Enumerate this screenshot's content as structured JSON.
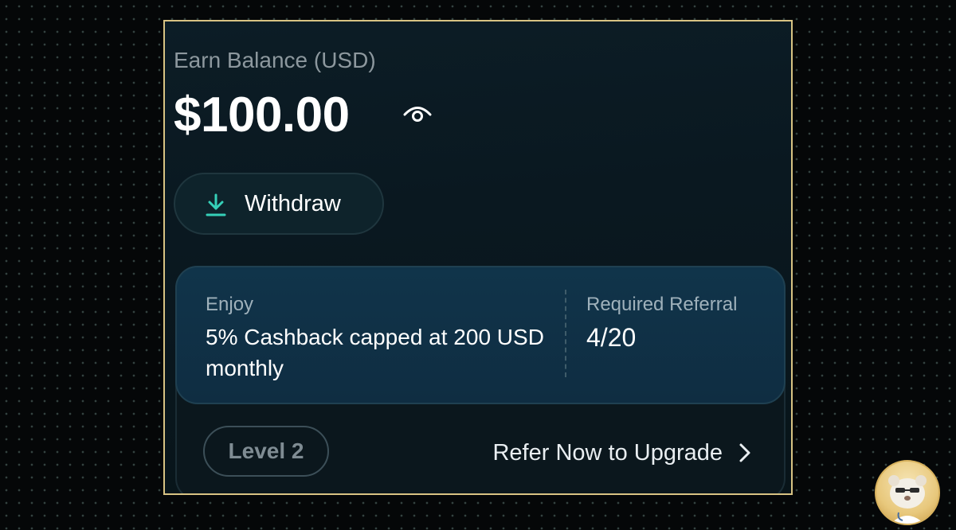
{
  "balance": {
    "label": "Earn Balance (USD)",
    "amount": "$100.00",
    "visibility_icon": "eye-icon"
  },
  "withdraw": {
    "label": "Withdraw",
    "icon": "download-icon"
  },
  "perk": {
    "enjoy_label": "Enjoy",
    "cashback": "5% Cashback capped at 200 USD monthly",
    "required_label": "Required Referral",
    "required_value": "4/20"
  },
  "level": {
    "badge": "Level 2",
    "refer_label": "Refer Now to Upgrade",
    "refer_icon": "chevron-right-icon"
  },
  "colors": {
    "accent": "#35d0b8",
    "frame_border": "#d8c383",
    "panel": "#10344a"
  }
}
